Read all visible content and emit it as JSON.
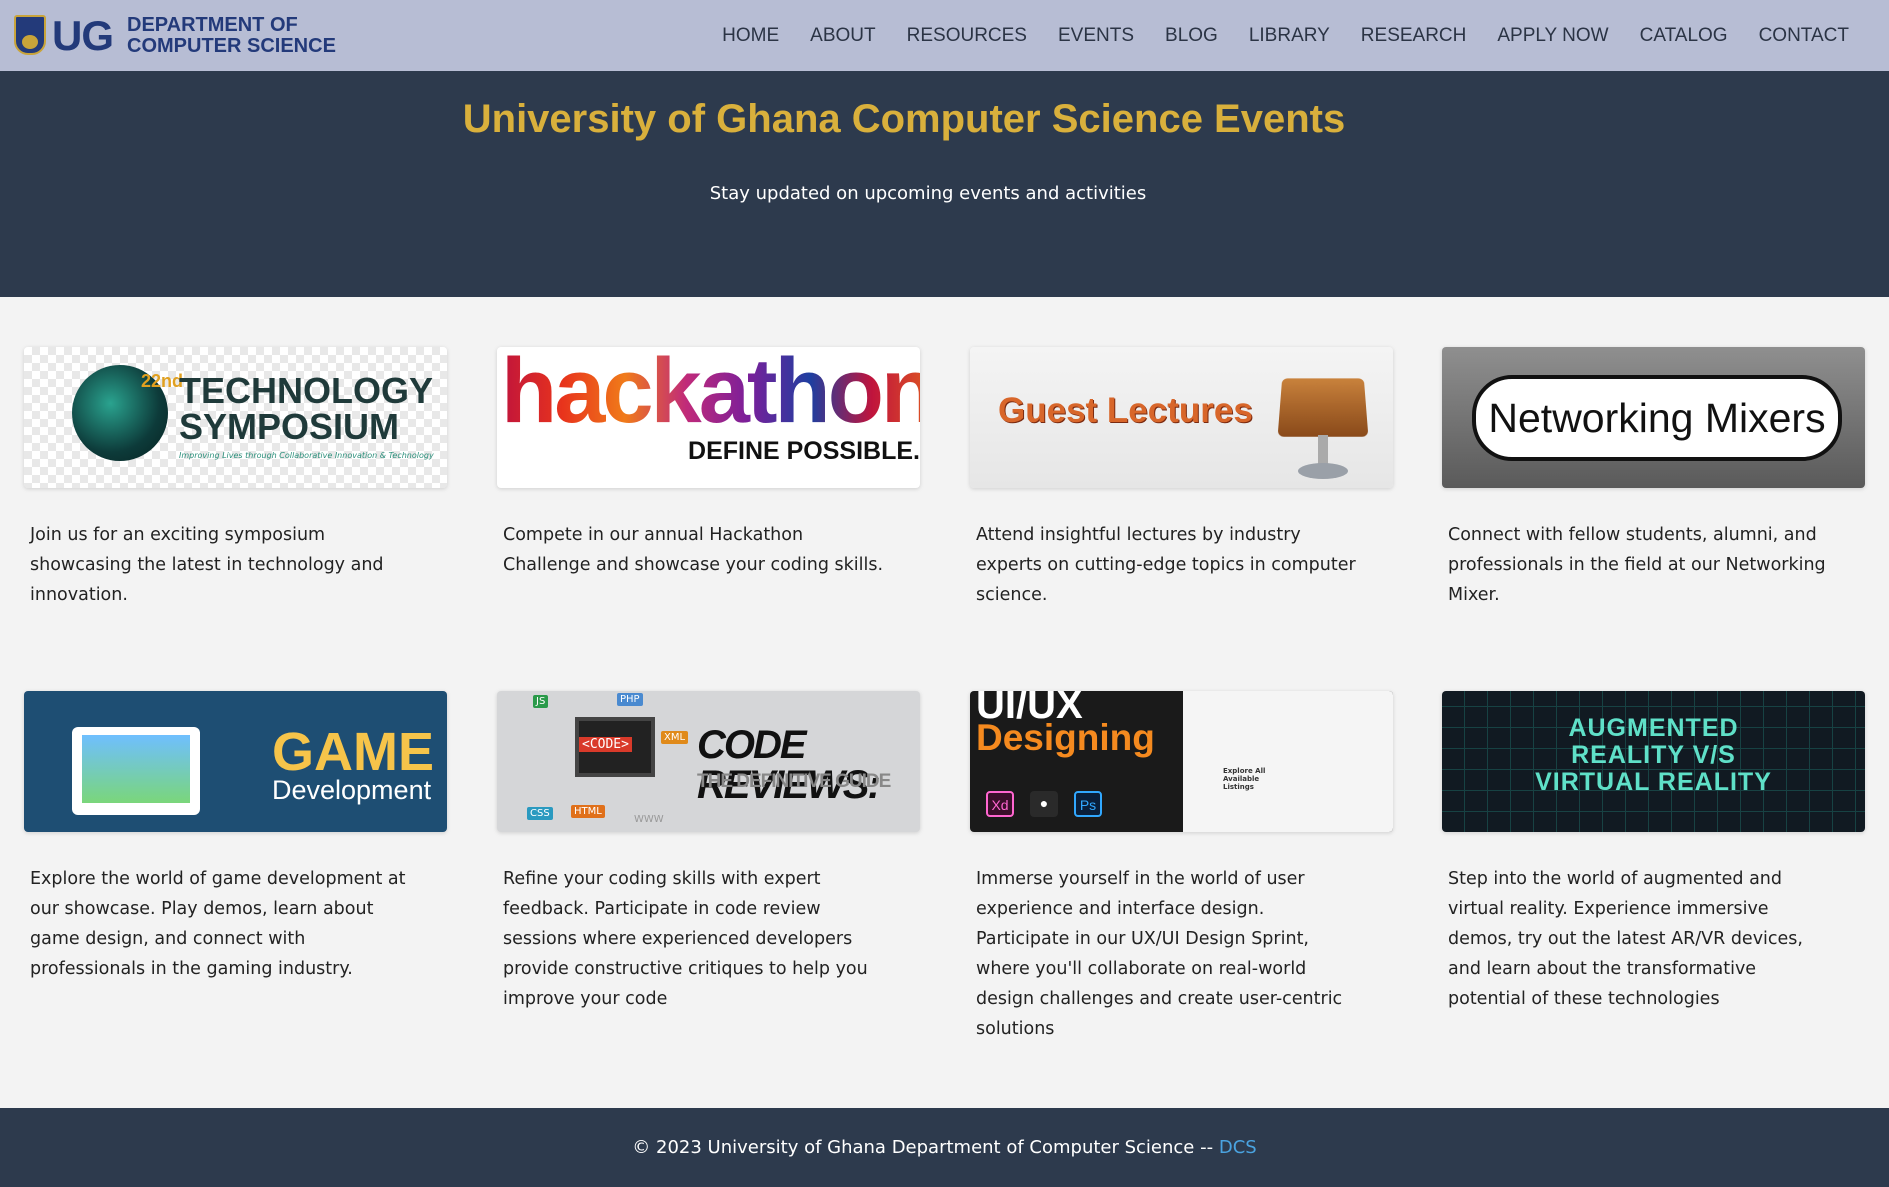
{
  "nav": {
    "logo_text": "UG",
    "department_line1": "DEPARTMENT OF",
    "department_line2": "COMPUTER SCIENCE",
    "items": [
      "HOME",
      "ABOUT",
      "RESOURCES",
      "EVENTS",
      "BLOG",
      "LIBRARY",
      "RESEARCH",
      "APPLY NOW",
      "CATALOG",
      "CONTACT"
    ]
  },
  "hero": {
    "title": "University of Ghana Computer Science Events",
    "subtitle": "Stay updated on upcoming events and activities"
  },
  "events": [
    {
      "image_text": [
        "22nd",
        "TECHNOLOGY",
        "SYMPOSIUM",
        "Improving Lives through Collaborative Innovation & Technology"
      ],
      "description": "Join us for an exciting symposium showcasing the latest in technology and innovation."
    },
    {
      "image_text": [
        "hackathon",
        "DEFINE POSSIBLE."
      ],
      "description": "Compete in our annual Hackathon Challenge and showcase your coding skills."
    },
    {
      "image_text": [
        "Guest Lectures"
      ],
      "description": "Attend insightful lectures by industry experts on cutting-edge topics in computer science."
    },
    {
      "image_text": [
        "Networking Mixers"
      ],
      "description": "Connect with fellow students, alumni, and professionals in the field at our Networking Mixer."
    },
    {
      "image_text": [
        "GAME",
        "Development"
      ],
      "description": "Explore the world of game development at our showcase. Play demos, learn about game design, and connect with professionals in the gaming industry."
    },
    {
      "image_text": [
        "CODE REVIEWS:",
        "THE DEFINITIVE GUIDE",
        "<CODE>",
        "JS",
        "PHP",
        "XML",
        "CSS",
        "HTML",
        "WWW"
      ],
      "description": "Refine your coding skills with expert feedback. Participate in code review sessions where experienced developers provide constructive critiques to help you improve your code"
    },
    {
      "image_text": [
        "UI/UX",
        "Designing",
        "Xd",
        "Ps",
        "Explore All Available Listings"
      ],
      "description": "Immerse yourself in the world of user experience and interface design. Participate in our UX/UI Design Sprint, where you'll collaborate on real-world design challenges and create user-centric solutions"
    },
    {
      "image_text": [
        "AUGMENTED",
        "REALITY V/S",
        "VIRTUAL REALITY"
      ],
      "description": "Step into the world of augmented and virtual reality. Experience immersive demos, try out the latest AR/VR devices, and learn about the transformative potential of these technologies"
    }
  ],
  "footer": {
    "text": "© 2023 University of Ghana Department of Computer Science -- ",
    "link": "DCS"
  },
  "colors": {
    "nav_bg": "#b7bdd4",
    "hero_bg": "#2d3a4d",
    "title_gold": "#d9b03c",
    "link_blue": "#4aa3e0"
  }
}
